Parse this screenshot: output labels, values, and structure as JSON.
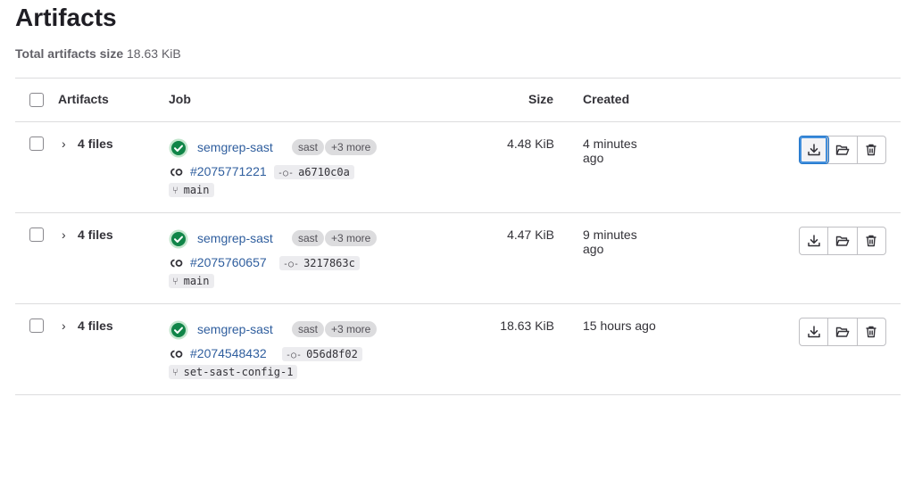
{
  "page": {
    "title": "Artifacts",
    "total_label": "Total artifacts size",
    "total_value": "18.63 KiB"
  },
  "table": {
    "headers": {
      "artifacts": "Artifacts",
      "job": "Job",
      "size": "Size",
      "created": "Created"
    },
    "rows": [
      {
        "files": "4 files",
        "job_name": "semgrep-sast",
        "stage_badge": "sast",
        "more_badge": "+3 more",
        "pipeline": "#2075771221",
        "commit": "a6710c0a",
        "branch": "main",
        "size": "4.48 KiB",
        "created": "4 minutes ago"
      },
      {
        "files": "4 files",
        "job_name": "semgrep-sast",
        "stage_badge": "sast",
        "more_badge": "+3 more",
        "pipeline": "#2075760657",
        "commit": "3217863c",
        "branch": "main",
        "size": "4.47 KiB",
        "created": "9 minutes ago"
      },
      {
        "files": "4 files",
        "job_name": "semgrep-sast",
        "stage_badge": "sast",
        "more_badge": "+3 more",
        "pipeline": "#2074548432",
        "commit": "056d8f02",
        "branch": "set-sast-config-1",
        "size": "18.63 KiB",
        "created": "15 hours ago"
      }
    ]
  },
  "icons": {
    "status": "status-success-icon",
    "download": "download-icon",
    "browse": "folder-open-icon",
    "delete": "trash-icon"
  },
  "colors": {
    "success": "#108548",
    "link": "#2f5e9e",
    "focus": "#1f75cb"
  }
}
